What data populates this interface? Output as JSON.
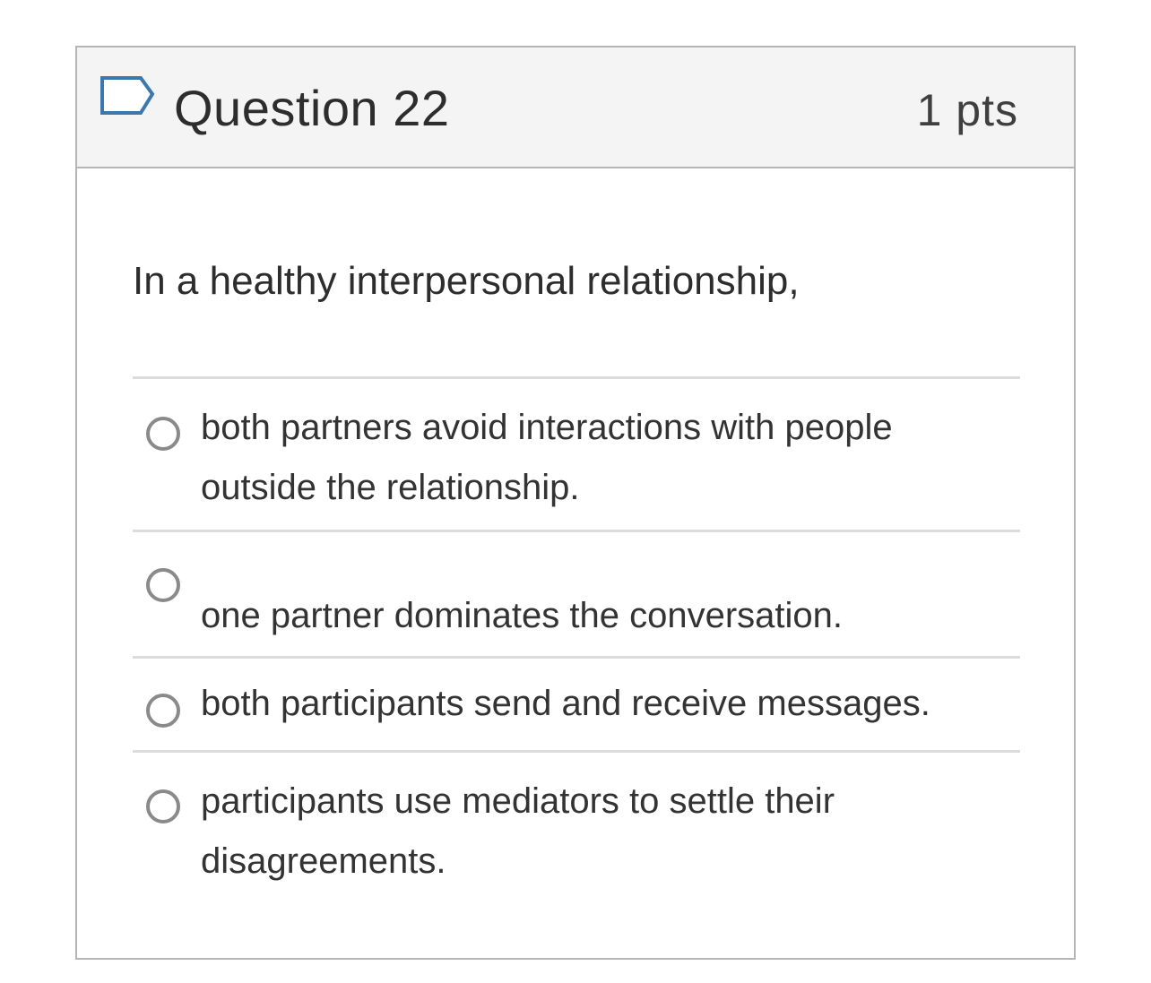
{
  "question": {
    "title": "Question 22",
    "points": "1 pts",
    "flag_icon": "flag-outline-icon",
    "prompt": "In a healthy interpersonal relationship,",
    "answers": [
      {
        "label": "both partners avoid interactions with people outside the relationship.",
        "selected": false
      },
      {
        "label": "one partner dominates the conversation.",
        "selected": false
      },
      {
        "label": "both participants send and receive messages.",
        "selected": false
      },
      {
        "label": "participants use mediators to settle their disagreements.",
        "selected": false
      }
    ]
  },
  "colors": {
    "header_bg": "#f4f4f4",
    "border": "#b5b5b5",
    "flag": "#3a78ad",
    "radio": "#8a8a8a"
  }
}
